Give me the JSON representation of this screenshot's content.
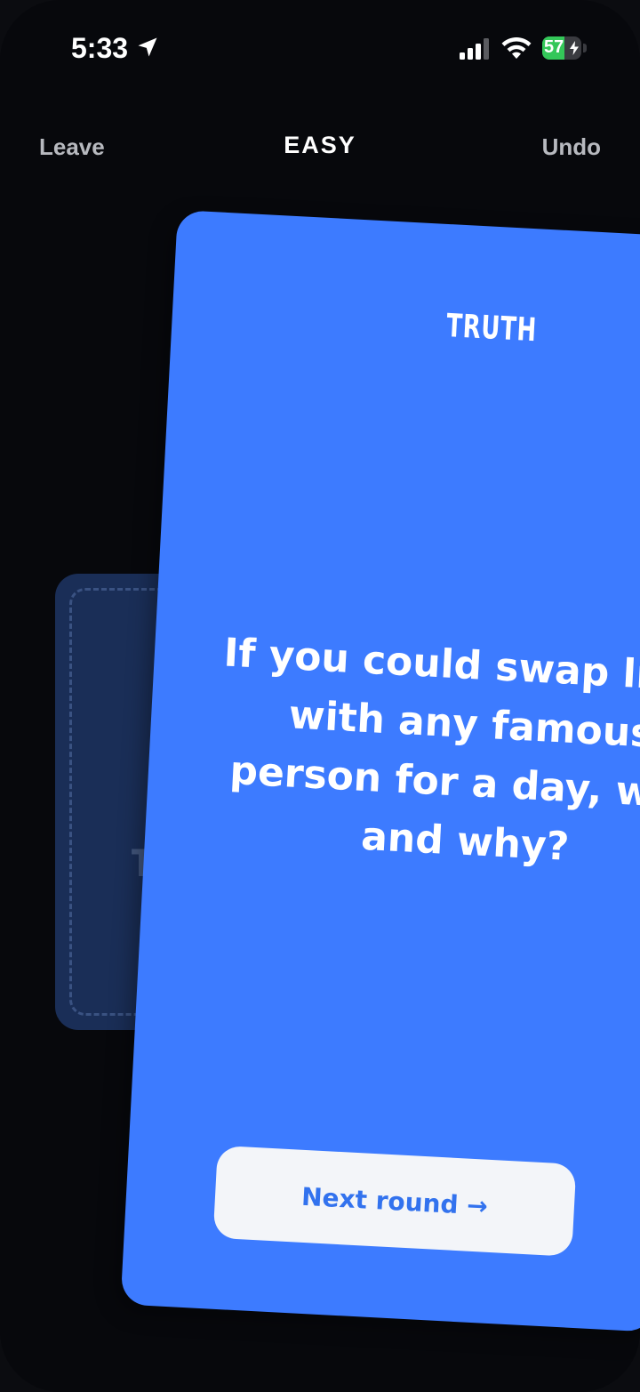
{
  "status_bar": {
    "time": "5:33",
    "battery_text": "57",
    "battery_level": 0.57,
    "icons": [
      "location-arrow-icon",
      "cellular-signal-icon",
      "wifi-icon",
      "battery-charging-icon"
    ]
  },
  "header": {
    "left_label": "Leave",
    "title": "EASY",
    "right_label": "Undo"
  },
  "background": {
    "hint_text": "Ta",
    "deck_label": "TR"
  },
  "card": {
    "type": "TRUTH",
    "question_lines": [
      "If you could swap lives",
      "with any famous",
      "person for a day, who",
      "and why?"
    ],
    "button_label": "Next round →"
  },
  "colors": {
    "card_blue": "#3d7bff",
    "deck_navy": "#1a2e57",
    "button_bg": "#f3f5f9",
    "button_text": "#3272ee",
    "background": "#07080c"
  }
}
